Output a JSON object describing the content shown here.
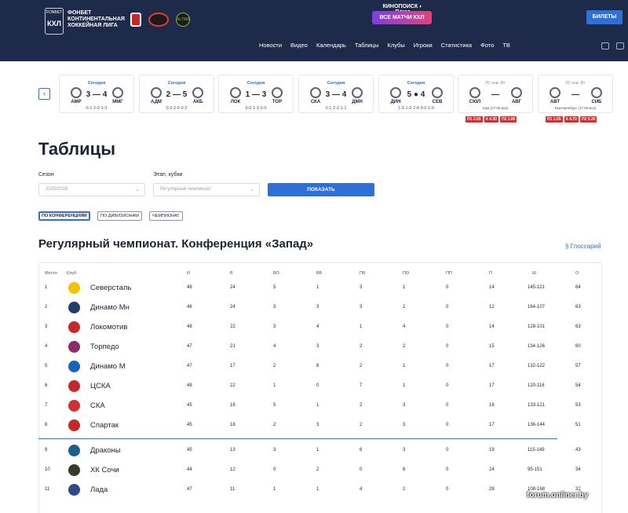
{
  "header": {
    "logo_top": "FONBET",
    "logo_mid": "КХЛ",
    "league_name": "ФОНБЕТ КОНТИНЕНТАЛЬНАЯ ХОККЕЙНАЯ ЛИГА",
    "partner3": "ALTIME",
    "promo_top": "КИНОПОИСК ◐ Плюс",
    "promo_button": "ВСЕ МАТЧИ КХЛ",
    "tickets": "БИЛЕТЫ",
    "nav": [
      "Новости",
      "Видео",
      "Календарь",
      "Таблицы",
      "Клубы",
      "Игроки",
      "Статистика",
      "Фото",
      "ТВ"
    ],
    "colors": {
      "header_bg": "#1e2a4a",
      "accent": "#2f6fd8"
    }
  },
  "games": [
    {
      "label": "Сегодня",
      "home": "АМР",
      "away": "ММГ",
      "score": "3 — 4",
      "periods": "0-1  2-0  1-3"
    },
    {
      "label": "Сегодня",
      "home": "АДМ",
      "away": "АКБ",
      "score": "2 — 5",
      "periods": "0-3  2-0  0-2"
    },
    {
      "label": "Сегодня",
      "home": "ЛОК",
      "away": "ТОР",
      "score": "1 — 3",
      "periods": "0-0  1-3  0-0"
    },
    {
      "label": "Сегодня",
      "home": "СКА",
      "away": "ДМН",
      "score": "3 — 4",
      "periods": "0-1  2-2  1-1"
    },
    {
      "label": "Сегодня",
      "home": "ДИН",
      "away": "СЕВ",
      "score": "5 ● 4",
      "periods": "1-0  1-0  2-4  0-0  1-0"
    },
    {
      "label": "20 янв, Вт",
      "home": "СЮЛ",
      "away": "АВГ",
      "score": "—",
      "place": "Уфа (17:00 мск)",
      "odds": [
        "П1 3.55",
        "Х 4.30",
        "П2 1.85"
      ]
    },
    {
      "label": "20 янв, Вт",
      "home": "АВТ",
      "away": "СИБ",
      "score": "—",
      "place": "Екатеринбург (17:00 мск)",
      "odds": [
        "П1 1.55",
        "Х 4.70",
        "П2 5.20"
      ]
    }
  ],
  "page": {
    "title": "Таблицы",
    "season_label": "Сезон",
    "season_value": "2025/2026",
    "stage_label": "Этап, кубки",
    "stage_value": "Регулярный чемпионат",
    "show_button": "ПОКАЗАТЬ",
    "tabs": [
      "ПО КОНФЕРЕНЦИЯМ",
      "ПО ДИВИЗИОНАМ",
      "ЧЕМПИОНАТ"
    ],
    "section_title": "Регулярный чемпионат. Конференция «Запад»",
    "glossary": "§ Глоссарий",
    "watermark": "forum.onliner.by"
  },
  "table": {
    "headers": [
      "Место",
      "Клуб",
      "И",
      "В",
      "ВО",
      "ВБ",
      "ПБ",
      "ПО",
      "ПП",
      "П",
      "Ш",
      "О"
    ],
    "rows": [
      {
        "place": "1",
        "club": "Северсталь",
        "color": "#f2c200",
        "i": "48",
        "v": "24",
        "vo": "5",
        "vb": "1",
        "pb": "3",
        "po": "1",
        "pp": "0",
        "p": "14",
        "sh": "145-121",
        "o": "64"
      },
      {
        "place": "2",
        "club": "Динамо Мн",
        "color": "#1f3f6e",
        "i": "46",
        "v": "24",
        "vo": "3",
        "vb": "3",
        "pb": "3",
        "po": "2",
        "pp": "0",
        "p": "12",
        "sh": "164-107",
        "o": "63"
      },
      {
        "place": "3",
        "club": "Локомотив",
        "color": "#c62828",
        "i": "48",
        "v": "22",
        "vo": "3",
        "vb": "4",
        "pb": "1",
        "po": "4",
        "pp": "0",
        "p": "14",
        "sh": "128-101",
        "o": "63"
      },
      {
        "place": "4",
        "club": "Торпедо",
        "color": "#8e2a6b",
        "i": "47",
        "v": "21",
        "vo": "4",
        "vb": "3",
        "pb": "2",
        "po": "2",
        "pp": "0",
        "p": "15",
        "sh": "134-126",
        "o": "60"
      },
      {
        "place": "5",
        "club": "Динамо М",
        "color": "#1565c0",
        "i": "47",
        "v": "17",
        "vo": "2",
        "vb": "8",
        "pb": "2",
        "po": "1",
        "pp": "0",
        "p": "17",
        "sh": "132-122",
        "o": "57"
      },
      {
        "place": "6",
        "club": "ЦСКА",
        "color": "#c62828",
        "i": "48",
        "v": "22",
        "vo": "1",
        "vb": "0",
        "pb": "7",
        "po": "1",
        "pp": "0",
        "p": "17",
        "sh": "120-116",
        "o": "54"
      },
      {
        "place": "7",
        "club": "СКА",
        "color": "#d32f2f",
        "i": "45",
        "v": "18",
        "vo": "5",
        "vb": "1",
        "pb": "2",
        "po": "3",
        "pp": "0",
        "p": "16",
        "sh": "133-121",
        "o": "53"
      },
      {
        "place": "8",
        "club": "Спартак",
        "color": "#c62828",
        "i": "45",
        "v": "18",
        "vo": "2",
        "vb": "3",
        "pb": "2",
        "po": "3",
        "pp": "0",
        "p": "17",
        "sh": "136-144",
        "o": "51"
      },
      {
        "place": "9",
        "club": "Драконы",
        "color": "#1b5e8a",
        "i": "45",
        "v": "13",
        "vo": "3",
        "vb": "1",
        "pb": "6",
        "po": "3",
        "pp": "0",
        "p": "19",
        "sh": "115-149",
        "o": "43"
      },
      {
        "place": "10",
        "club": "ХК Сочи",
        "color": "#3a3a2a",
        "i": "44",
        "v": "12",
        "vo": "0",
        "vb": "2",
        "pb": "0",
        "po": "6",
        "pp": "0",
        "p": "24",
        "sh": "95-151",
        "o": "34"
      },
      {
        "place": "11",
        "club": "Лада",
        "color": "#2f4a8a",
        "i": "47",
        "v": "11",
        "vo": "1",
        "vb": "1",
        "pb": "4",
        "po": "2",
        "pp": "0",
        "p": "28",
        "sh": "108-168",
        "o": "32"
      }
    ]
  }
}
